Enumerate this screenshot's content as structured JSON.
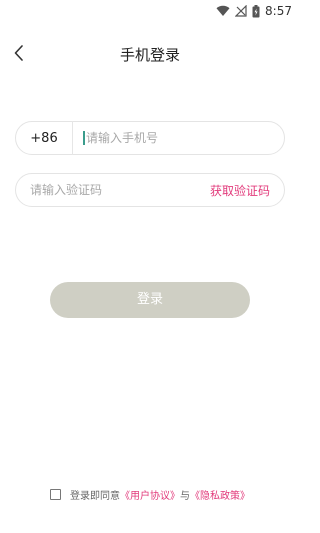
{
  "status_bar": {
    "time": "8:57",
    "icons": [
      "wifi-icon",
      "signal-no-sim-icon",
      "battery-charging-icon"
    ]
  },
  "header": {
    "back_icon": "chevron-left-icon",
    "title": "手机登录"
  },
  "phone": {
    "country_code": "+86",
    "placeholder": "请输入手机号",
    "value": ""
  },
  "code": {
    "placeholder": "请输入验证码",
    "value": "",
    "get_code_label": "获取验证码"
  },
  "login": {
    "label": "登录"
  },
  "agreement": {
    "checked": false,
    "prefix": "登录即同意",
    "user_agreement": "《用户协议》",
    "conjunction": "与",
    "privacy_policy": "《隐私政策》"
  },
  "colors": {
    "accent": "#e23a7b",
    "login_button_disabled": "#cfcfc4",
    "cursor": "#3a9c8c"
  }
}
